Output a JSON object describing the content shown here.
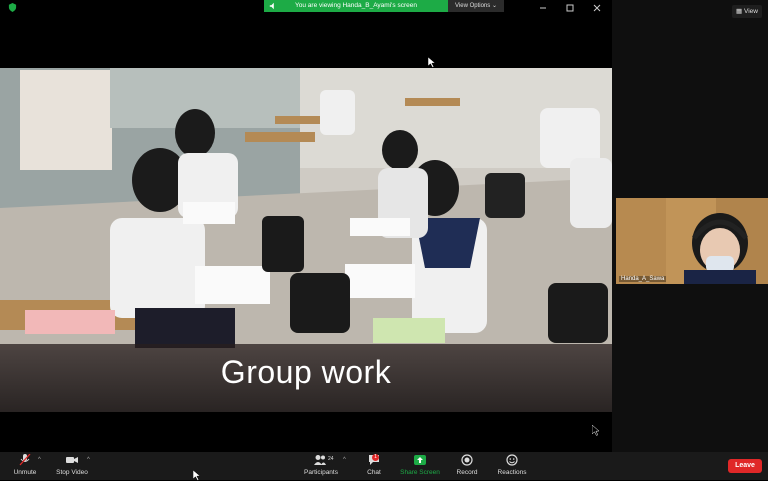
{
  "banner": {
    "text": "You are viewing Handa_B_Ayami's screen",
    "view_options": "View Options ⌄"
  },
  "main_video": {
    "caption": "Group work"
  },
  "right_panel": {
    "view_label": "View",
    "participant_name": "Handa_A_Sawa"
  },
  "toolbar": {
    "unmute": "Unmute",
    "stop_video": "Stop Video",
    "participants": "Participants",
    "participants_count": "24",
    "chat": "Chat",
    "chat_badge": "1",
    "share_screen": "Share Screen",
    "record": "Record",
    "reactions": "Reactions",
    "leave": "Leave"
  },
  "colors": {
    "share_green": "#1dab46",
    "leave_red": "#e02828",
    "toolbar_bg": "#1a1a1a"
  }
}
